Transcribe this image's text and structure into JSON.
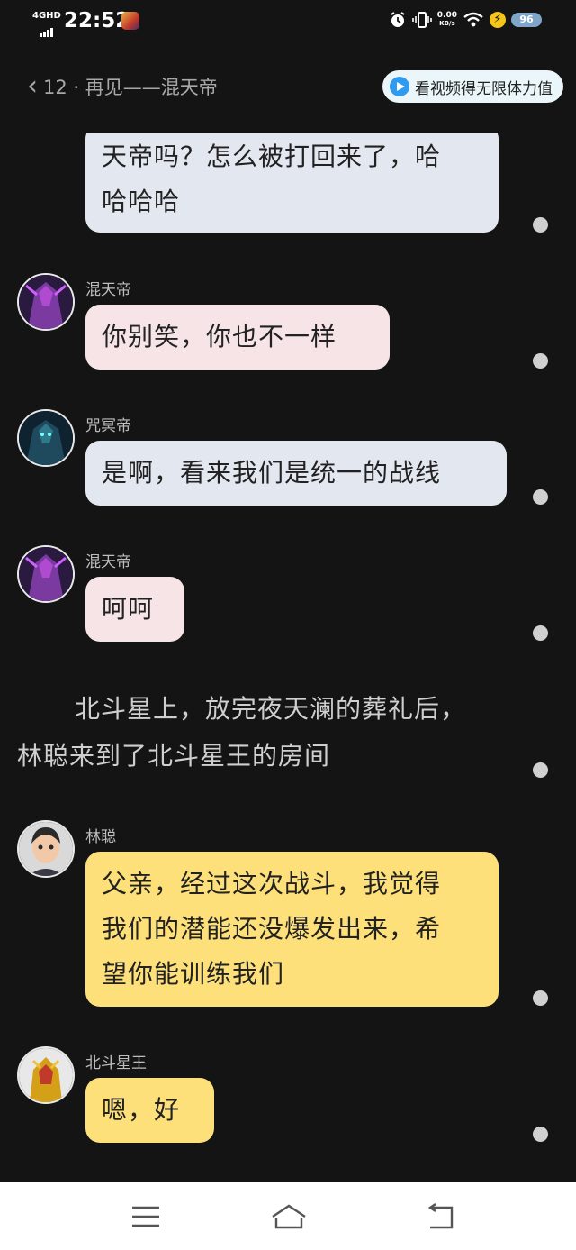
{
  "status": {
    "network": "4GHD",
    "time": "22:52",
    "speed_value": "0.00",
    "speed_unit": "KB/s",
    "battery": "96",
    "icons": [
      "alarm-icon",
      "vibrate-icon",
      "wifi-icon",
      "charging-icon"
    ]
  },
  "header": {
    "title": "12 · 再见——混天帝",
    "promo": "看视频得无限体力值"
  },
  "messages": [
    {
      "type": "bubble",
      "style": "blue",
      "text_lines": [
        "天帝吗？怎么被打回来了，哈",
        "哈哈哈"
      ]
    },
    {
      "type": "bubble",
      "speaker": "混天帝",
      "style": "pink",
      "text": "你别笑，你也不一样"
    },
    {
      "type": "bubble",
      "speaker": "咒冥帝",
      "style": "blue",
      "text": "是啊，看来我们是统一的战线"
    },
    {
      "type": "bubble",
      "speaker": "混天帝",
      "style": "pink",
      "text": "呵呵"
    },
    {
      "type": "narration",
      "text_lines": [
        "北斗星上，放完夜天澜的葬礼后，",
        "林聪来到了北斗星王的房间"
      ]
    },
    {
      "type": "bubble",
      "speaker": "林聪",
      "style": "yellow",
      "text_lines": [
        "父亲，经过这次战斗，我觉得",
        "我们的潜能还没爆发出来，希",
        "望你能训练我们"
      ]
    },
    {
      "type": "bubble",
      "speaker": "北斗星王",
      "style": "yellow",
      "text": "嗯，好"
    }
  ],
  "colors": {
    "background": "#141414",
    "bubble_blue": "#e2e7f0",
    "bubble_pink": "#f6e4e6",
    "bubble_yellow": "#fde07a",
    "promo_bg": "#eaf6f9",
    "promo_icon": "#2e9af0"
  },
  "navbar": {
    "icons": [
      "menu-icon",
      "home-icon",
      "back-icon"
    ]
  }
}
